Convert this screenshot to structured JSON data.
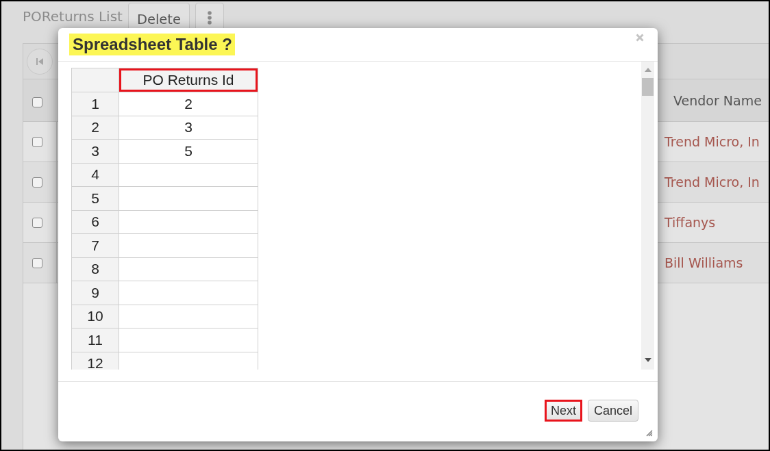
{
  "page": {
    "title": "POReturns List",
    "delete_button": "Delete"
  },
  "grid": {
    "select_all": {
      "checked": false
    },
    "vendor_column": "Vendor Name",
    "rows": [
      {
        "checked": false,
        "vendor_name": "Trend Micro, In"
      },
      {
        "checked": false,
        "vendor_name": "Trend Micro, In"
      },
      {
        "checked": false,
        "vendor_name": "Tiffanys"
      },
      {
        "checked": false,
        "vendor_name": "Bill Williams"
      }
    ]
  },
  "dialog": {
    "title": {
      "text": "Spreadsheet Table ?",
      "highlighted": true
    },
    "sheet": {
      "columns": [
        {
          "label": "PO Returns Id",
          "highlighted": true
        }
      ],
      "rows": [
        {
          "number": "1",
          "cells": [
            "2"
          ]
        },
        {
          "number": "2",
          "cells": [
            "3"
          ]
        },
        {
          "number": "3",
          "cells": [
            "5"
          ]
        },
        {
          "number": "4"
        },
        {
          "number": "5"
        },
        {
          "number": "6"
        },
        {
          "number": "7"
        },
        {
          "number": "8"
        },
        {
          "number": "9"
        },
        {
          "number": "10"
        },
        {
          "number": "11"
        },
        {
          "number": "12"
        }
      ]
    },
    "buttons": [
      {
        "label": "Next",
        "highlighted": true
      },
      {
        "label": "Cancel",
        "highlighted": false
      }
    ]
  }
}
